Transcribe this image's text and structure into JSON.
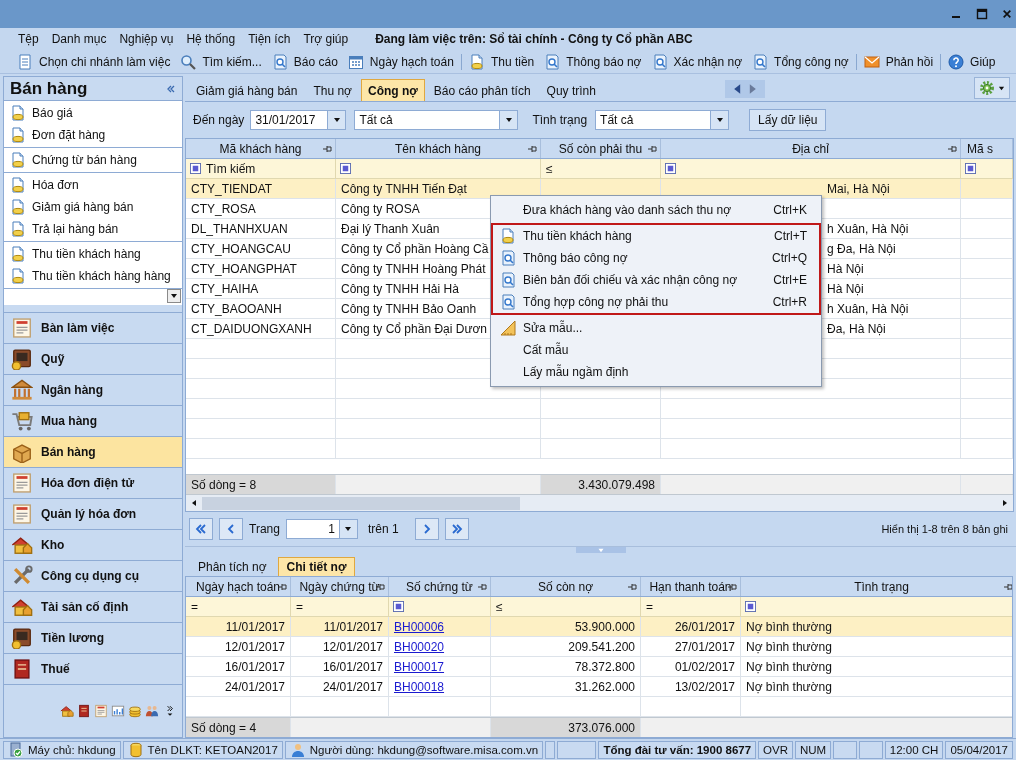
{
  "menu_bar": {
    "items": [
      "Tệp",
      "Danh mục",
      "Nghiệp vụ",
      "Hệ thống",
      "Tiện ích",
      "Trợ giúp"
    ],
    "context": "Đang làm việc trên: Sổ tài chính - Công ty Cổ phần ABC"
  },
  "toolbar": {
    "groups": [
      {
        "items": [
          "Chọn chi nhánh làm việc",
          "Tìm kiếm...",
          "Báo cáo",
          "Ngày hạch toán"
        ]
      },
      {
        "items": [
          "Thu tiền",
          "Thông báo nợ",
          "Xác nhận nợ",
          "Tổng công nợ"
        ]
      },
      {
        "items": [
          "Phản hồi"
        ]
      },
      {
        "items": [
          "Giúp"
        ]
      }
    ]
  },
  "sidebar": {
    "title": "Bán hàng",
    "groups": [
      {
        "items": [
          "Báo giá",
          "Đơn đặt hàng"
        ]
      },
      {
        "items": [
          "Chứng từ bán hàng"
        ]
      },
      {
        "items": [
          "Hóa đơn",
          "Giảm giá hàng bán",
          "Trả lại hàng bán"
        ]
      },
      {
        "items": [
          "Thu tiền khách hàng",
          "Thu tiền khách hàng hàng"
        ]
      }
    ],
    "modules": [
      {
        "label": "Bàn làm việc",
        "selected": false
      },
      {
        "label": "Quỹ",
        "selected": false
      },
      {
        "label": "Ngân hàng",
        "selected": false
      },
      {
        "label": "Mua hàng",
        "selected": false
      },
      {
        "label": "Bán hàng",
        "selected": true
      },
      {
        "label": "Hóa đơn điện tử",
        "selected": false
      },
      {
        "label": "Quản lý hóa đơn",
        "selected": false
      },
      {
        "label": "Kho",
        "selected": false
      },
      {
        "label": "Công cụ dụng cụ",
        "selected": false
      },
      {
        "label": "Tài sản cố định",
        "selected": false
      },
      {
        "label": "Tiền lương",
        "selected": false
      },
      {
        "label": "Thuế",
        "selected": false
      }
    ]
  },
  "tabs": [
    {
      "label": "Giảm giá hàng bán",
      "selected": false
    },
    {
      "label": "Thu nợ",
      "selected": false
    },
    {
      "label": "Công nợ",
      "selected": true
    },
    {
      "label": "Báo cáo phân tích",
      "selected": false
    },
    {
      "label": "Quy trình",
      "selected": false
    }
  ],
  "filters": {
    "date_label": "Đến ngày",
    "date": "31/01/2017",
    "scope": "Tất cả",
    "status_label": "Tình trạng",
    "status": "Tất cả",
    "button": "Lấy dữ liệu"
  },
  "customer_table": {
    "columns": [
      "Mã khách hàng",
      "Tên khách hàng",
      "Số còn phải thu",
      "Địa chỉ",
      "Mã s"
    ],
    "filter": [
      {
        "kind": "search",
        "text": "Tìm kiếm"
      },
      {
        "kind": "square"
      },
      {
        "kind": "operator",
        "text": "≤"
      },
      {
        "kind": "square"
      },
      {
        "kind": "square"
      }
    ],
    "rows": [
      {
        "code": "CTY_TIENDAT",
        "name": "Công ty TNHH Tiến Đạt",
        "address": "Mai, Hà Nội",
        "selected": true
      },
      {
        "code": "CTY_ROSA",
        "name": "Công ty ROSA",
        "selected": false
      },
      {
        "code": "DL_THANHXUAN",
        "name": "Đại lý Thanh Xuân",
        "address": "h Xuân, Hà Nội",
        "selected": false
      },
      {
        "code": "CTY_HOANGCAU",
        "name": "Công ty Cổ phần Hoàng Cầ",
        "address": "g Đa, Hà Nội",
        "selected": false
      },
      {
        "code": "CTY_HOANGPHAT",
        "name": "Công ty TNHH Hoàng Phát",
        "address": "Hà Nội",
        "selected": false
      },
      {
        "code": "CTY_HAIHA",
        "name": "Công ty TNHH Hải Hà",
        "address": "Hà Nội",
        "selected": false
      },
      {
        "code": "CTY_BAOOANH",
        "name": "Công ty TNHH Bảo Oanh",
        "address": "h Xuân, Hà Nội",
        "selected": false
      },
      {
        "code": "CT_DAIDUONGXANH",
        "name": "Công ty Cổ phần Đại Dươn",
        "address": "Đa, Hà Nội",
        "selected": false
      }
    ],
    "footer": {
      "count": "Số dòng = 8",
      "total": "3.430.079.498"
    }
  },
  "pager": {
    "page_label": "Trang",
    "page": "1",
    "of": "trên 1",
    "summary": "Hiển thị 1-8 trên 8 bản ghi"
  },
  "detail_tabs": [
    {
      "label": "Phân tích nợ",
      "selected": false
    },
    {
      "label": "Chi tiết nợ",
      "selected": true
    }
  ],
  "debt_table": {
    "columns": [
      "Ngày hạch toán",
      "Ngày chứng từ",
      "Số chứng từ",
      "Số còn nợ",
      "Hạn thanh toán",
      "Tình trạng"
    ],
    "filter": [
      {
        "kind": "operator",
        "text": "="
      },
      {
        "kind": "operator",
        "text": "="
      },
      {
        "kind": "square"
      },
      {
        "kind": "operator",
        "text": "≤"
      },
      {
        "kind": "operator",
        "text": "="
      },
      {
        "kind": "square"
      }
    ],
    "rows": [
      {
        "posting_date": "11/01/2017",
        "voucher_date": "11/01/2017",
        "voucher_no": "BH00006",
        "amount": "53.900.000",
        "due_date": "26/01/2017",
        "status": "Nợ bình thường",
        "selected": true
      },
      {
        "posting_date": "12/01/2017",
        "voucher_date": "12/01/2017",
        "voucher_no": "BH00020",
        "amount": "209.541.200",
        "due_date": "27/01/2017",
        "status": "Nợ bình thường",
        "selected": false
      },
      {
        "posting_date": "16/01/2017",
        "voucher_date": "16/01/2017",
        "voucher_no": "BH00017",
        "amount": "78.372.800",
        "due_date": "01/02/2017",
        "status": "Nợ bình thường",
        "selected": false
      },
      {
        "posting_date": "24/01/2017",
        "voucher_date": "24/01/2017",
        "voucher_no": "BH00018",
        "amount": "31.262.000",
        "due_date": "13/02/2017",
        "status": "Nợ bình thường",
        "selected": false
      }
    ],
    "footer": {
      "count": "Số dòng = 4",
      "total": "373.076.000"
    }
  },
  "context_menu": {
    "groups": [
      {
        "highlighted": false,
        "items": [
          {
            "label": "Đưa khách hàng vào danh sách thu nợ",
            "shortcut": "Ctrl+K"
          }
        ]
      },
      {
        "highlighted": true,
        "items": [
          {
            "label": "Thu tiền khách hàng",
            "shortcut": "Ctrl+T"
          },
          {
            "label": "Thông báo công nợ",
            "shortcut": "Ctrl+Q"
          },
          {
            "label": "Biên bản đối chiếu và xác nhận công nợ",
            "shortcut": "Ctrl+E"
          },
          {
            "label": "Tổng hợp công nợ phải thu",
            "shortcut": "Ctrl+R"
          }
        ]
      },
      {
        "highlighted": false,
        "items": [
          {
            "label": "Sửa mẫu..."
          },
          {
            "label": "Cất mẫu"
          },
          {
            "label": "Lấy mẫu ngầm định"
          }
        ]
      }
    ]
  },
  "status_bar": {
    "server": "Máy chủ: hkdung",
    "database": "Tên DLKT: KETOAN2017",
    "user": "Người dùng: hkdung@software.misa.com.vn",
    "hotline": "Tổng đài tư vấn: 1900 8677",
    "ovr": "OVR",
    "num": "NUM",
    "time": "12:00 CH",
    "date": "05/04/2017"
  }
}
